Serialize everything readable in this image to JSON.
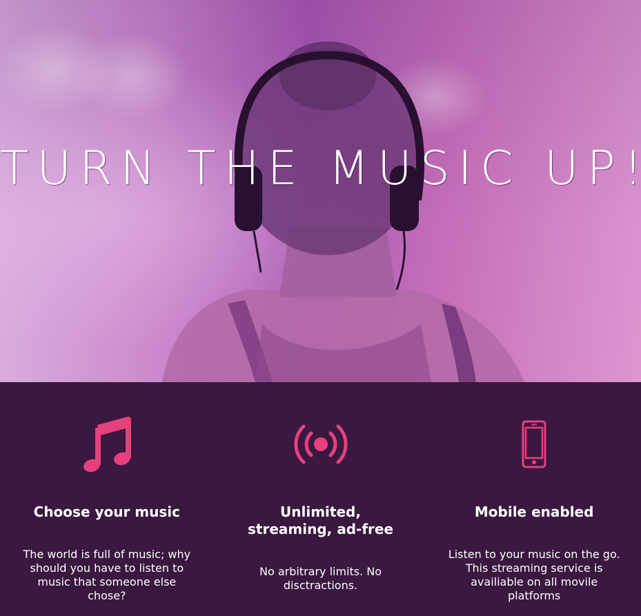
{
  "hero": {
    "title": "TURN THE MUSIC UP!"
  },
  "features": [
    {
      "icon": "music-note-icon",
      "title": "Choose your music",
      "text": "The world is full of music; why should you have to listen to music that someone else chose?"
    },
    {
      "icon": "broadcast-icon",
      "title": "Unlimited, streaming, ad-free",
      "text": "No arbitrary limits. No disctractions."
    },
    {
      "icon": "mobile-phone-icon",
      "title": "Mobile enabled",
      "text": "Listen to your music on the go. This streaming service is availiable on all movile platforms"
    }
  ],
  "colors": {
    "accent": "#e6407f",
    "features_background": "#3a1840",
    "text": "#ffffff"
  }
}
